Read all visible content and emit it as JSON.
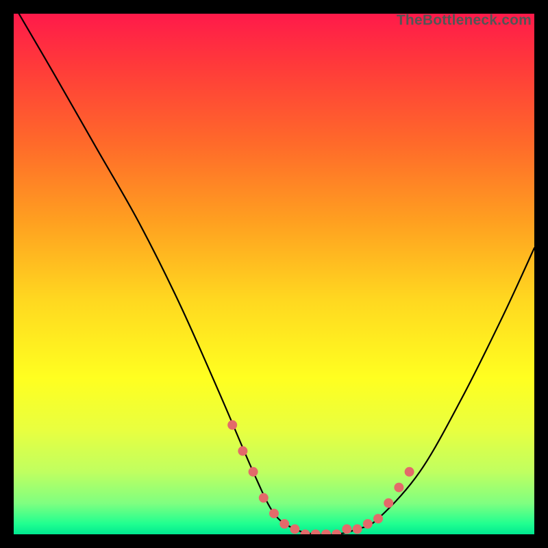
{
  "brand": "TheBottleneck.com",
  "chart_data": {
    "type": "line",
    "title": "",
    "xlabel": "",
    "ylabel": "",
    "xlim": [
      0,
      100
    ],
    "ylim": [
      0,
      100
    ],
    "grid": false,
    "legend": false,
    "series": [
      {
        "name": "bottleneck-curve",
        "color": "#000000",
        "x": [
          1,
          8,
          16,
          24,
          32,
          40,
          46,
          50,
          54,
          58,
          62,
          66,
          70,
          78,
          86,
          94,
          100
        ],
        "y": [
          100,
          88,
          74,
          60,
          44,
          26,
          12,
          4,
          1,
          0,
          0,
          1,
          3,
          12,
          26,
          42,
          55
        ]
      }
    ],
    "markers": {
      "name": "highlighted-points",
      "color": "#e36a6a",
      "approximate": true,
      "x": [
        42,
        44,
        46,
        48,
        50,
        52,
        54,
        56,
        58,
        60,
        62,
        64,
        66,
        68,
        70,
        72,
        74,
        76
      ],
      "y": [
        21,
        16,
        12,
        7,
        4,
        2,
        1,
        0,
        0,
        0,
        0,
        1,
        1,
        2,
        3,
        6,
        9,
        12
      ]
    },
    "gradient_stops": [
      {
        "pos": 0.0,
        "color": "#ff1a4a"
      },
      {
        "pos": 0.1,
        "color": "#ff3a3a"
      },
      {
        "pos": 0.25,
        "color": "#ff6a2a"
      },
      {
        "pos": 0.4,
        "color": "#ffa020"
      },
      {
        "pos": 0.55,
        "color": "#ffd820"
      },
      {
        "pos": 0.7,
        "color": "#ffff20"
      },
      {
        "pos": 0.8,
        "color": "#e8ff40"
      },
      {
        "pos": 0.88,
        "color": "#c0ff60"
      },
      {
        "pos": 0.94,
        "color": "#80ff80"
      },
      {
        "pos": 0.98,
        "color": "#20ff90"
      },
      {
        "pos": 1.0,
        "color": "#00e890"
      }
    ]
  }
}
